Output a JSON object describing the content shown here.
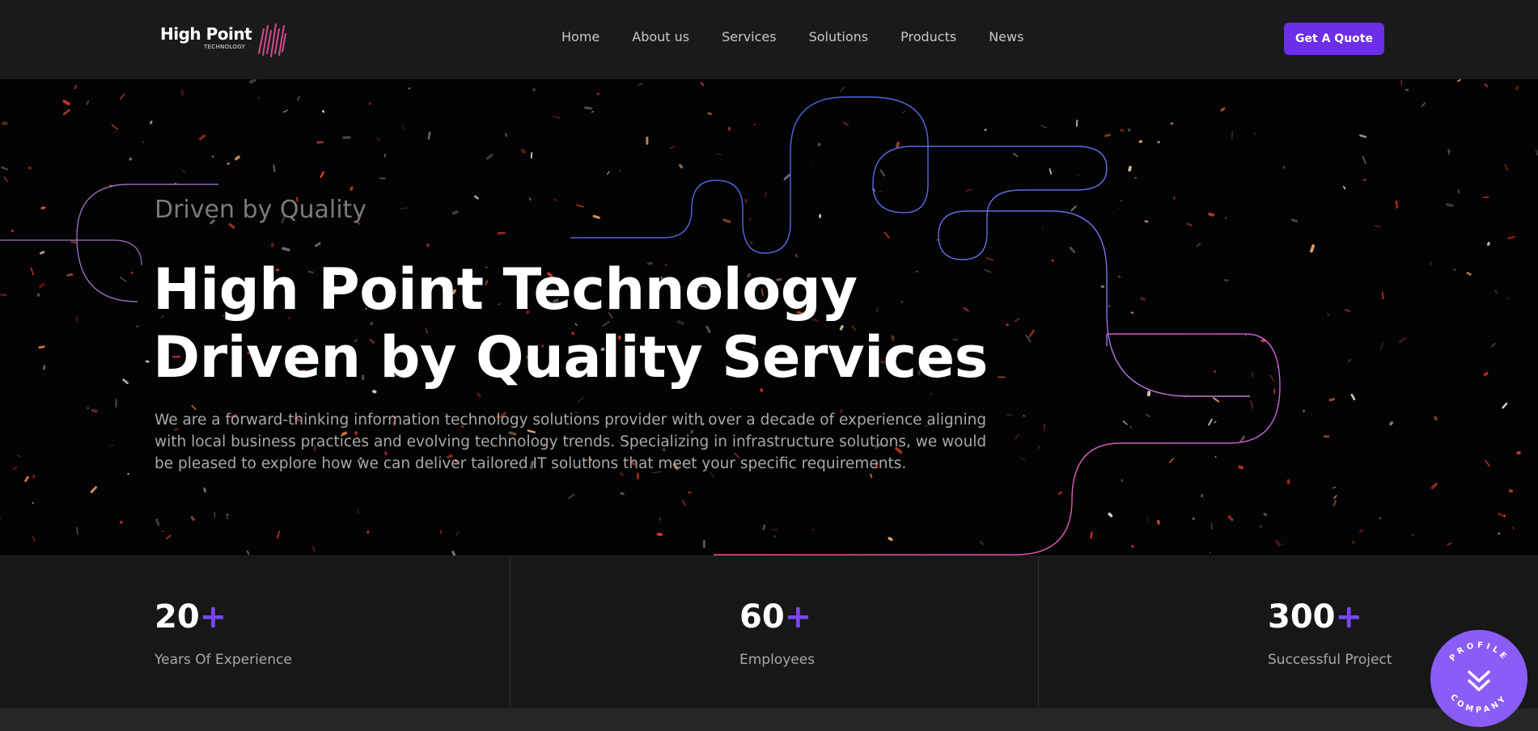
{
  "header": {
    "logo_title": "High Point",
    "logo_subtitle": "TECHNOLOGY",
    "nav": [
      "Home",
      "About us",
      "Services",
      "Solutions",
      "Products",
      "News"
    ],
    "cta_label": "Get A Quote"
  },
  "hero": {
    "eyebrow": "Driven by Quality",
    "headline_line1": "High Point Technology",
    "headline_line2": "Driven by Quality Services",
    "description": "We are a forward-thinking information technology solutions provider with over a decade of experience aligning with local business practices and evolving technology trends. Specializing in infrastructure solutions, we would be pleased to explore how we can deliver tailored IT solutions that meet your specific requirements."
  },
  "stats": [
    {
      "number": "20",
      "suffix": "+",
      "label": "Years Of Experience"
    },
    {
      "number": "60",
      "suffix": "+",
      "label": "Employees"
    },
    {
      "number": "300",
      "suffix": "+",
      "label": "Successful Project"
    }
  ],
  "badge": {
    "text_top": "PROFILE",
    "text_bottom": "COMPANY",
    "icon": "double-chevron-down-icon"
  },
  "colors": {
    "accent": "#6c2ee6",
    "plus": "#7a45f0",
    "badge": "#8b5cf6",
    "line_blue": "#4f6fe0",
    "line_pink": "#e06a9a"
  }
}
